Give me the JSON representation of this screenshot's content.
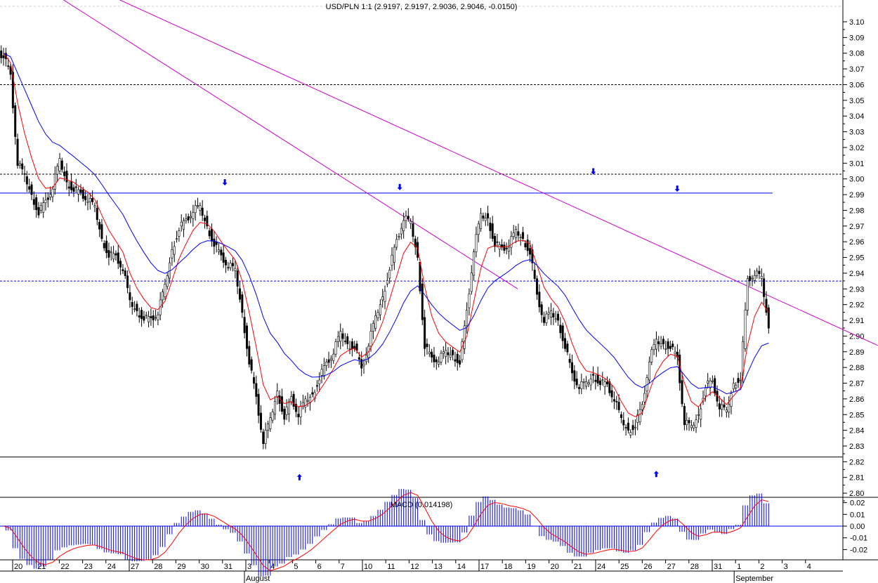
{
  "chart_data": {
    "type": "candlestick",
    "title": "USD/PLN 1:1 (2.9197, 2.9197, 2.9036, 2.9046, -0.0150)",
    "ylim": [
      2.8,
      3.1
    ],
    "yticks": [
      "3.10",
      "3.09",
      "3.08",
      "3.07",
      "3.06",
      "3.05",
      "3.04",
      "3.03",
      "3.02",
      "3.01",
      "3.00",
      "2.99",
      "2.98",
      "2.97",
      "2.96",
      "2.95",
      "2.94",
      "2.93",
      "2.92",
      "2.91",
      "2.90",
      "2.89",
      "2.88",
      "2.87",
      "2.86",
      "2.85",
      "2.84",
      "2.83",
      "2.82",
      "2.81",
      "2.80"
    ],
    "xticks": [
      "20",
      "21",
      "22",
      "23",
      "24",
      "27",
      "28",
      "29",
      "30",
      "31",
      "3",
      "4",
      "5",
      "6",
      "7",
      "10",
      "11",
      "12",
      "13",
      "14",
      "17",
      "18",
      "19",
      "20",
      "21",
      "24",
      "25",
      "26",
      "27",
      "28",
      "31",
      "1",
      "2",
      "3",
      "4"
    ],
    "week_starts": [
      0,
      5,
      10,
      15,
      20,
      25,
      30
    ],
    "months": [
      {
        "label": "August",
        "day_index": 10
      },
      {
        "label": "September",
        "day_index": 31
      }
    ],
    "series_start_day": -0.39,
    "series_step_days": 0.301,
    "closes": [
      3.08,
      3.065,
      3.01,
      3.0,
      2.99,
      2.98,
      2.985,
      2.995,
      3.01,
      2.998,
      2.995,
      2.99,
      2.987,
      2.98,
      2.962,
      2.953,
      2.95,
      2.943,
      2.92,
      2.916,
      2.913,
      2.91,
      2.915,
      2.93,
      2.955,
      2.97,
      2.973,
      2.98,
      2.98,
      2.97,
      2.96,
      2.95,
      2.945,
      2.94,
      2.915,
      2.885,
      2.86,
      2.833,
      2.845,
      2.865,
      2.85,
      2.86,
      2.85,
      2.857,
      2.863,
      2.875,
      2.882,
      2.89,
      2.9,
      2.895,
      2.895,
      2.878,
      2.895,
      2.91,
      2.925,
      2.945,
      2.96,
      2.975,
      2.97,
      2.95,
      2.895,
      2.885,
      2.885,
      2.888,
      2.888,
      2.885,
      2.915,
      2.955,
      2.975,
      2.975,
      2.96,
      2.955,
      2.958,
      2.965,
      2.962,
      2.955,
      2.925,
      2.91,
      2.913,
      2.91,
      2.895,
      2.875,
      2.868,
      2.868,
      2.875,
      2.872,
      2.868,
      2.86,
      2.845,
      2.84,
      2.845,
      2.855,
      2.885,
      2.895,
      2.895,
      2.895,
      2.885,
      2.845,
      2.84,
      2.85,
      2.87,
      2.87,
      2.855,
      2.85,
      2.87,
      2.875,
      2.935,
      2.94,
      2.935,
      2.905
    ],
    "moving_averages": [
      {
        "name": "fast",
        "period": 4,
        "color": "#ff0000"
      },
      {
        "name": "slow",
        "period": 12,
        "color": "#0000ff"
      }
    ],
    "horizontal_lines": [
      {
        "price": 3.06,
        "color": "#000000",
        "style": "dashed"
      },
      {
        "price": 3.003,
        "color": "#000000",
        "style": "dashed"
      },
      {
        "price": 2.991,
        "color": "#0000ff",
        "style": "solid"
      },
      {
        "price": 2.935,
        "color": "#0000ff",
        "style": "dashed"
      },
      {
        "price": 2.823,
        "color": "#000000",
        "style": "solid"
      }
    ],
    "trend_lines": [
      {
        "from": [
          2.17,
          3.114
        ],
        "to": [
          21.66,
          2.93
        ],
        "color": "#cc00cc"
      },
      {
        "from": [
          4.58,
          3.114
        ],
        "to": [
          37.1,
          2.894
        ],
        "color": "#cc00cc"
      }
    ],
    "arrows": [
      {
        "dir": "down",
        "day": 9.1,
        "price": 2.998
      },
      {
        "dir": "down",
        "day": 16.6,
        "price": 2.995
      },
      {
        "dir": "down",
        "day": 24.9,
        "price": 3.005
      },
      {
        "dir": "down",
        "day": 28.5,
        "price": 2.994
      },
      {
        "dir": "up",
        "day": 12.3,
        "price": 2.81
      },
      {
        "dir": "up",
        "day": 27.6,
        "price": 2.812
      }
    ],
    "macd": {
      "label": "MACD (0.014198)",
      "ylim": [
        -0.025,
        0.025
      ],
      "yticks": [
        "0.02",
        "0.01",
        "0.00",
        "-0.01",
        "-0.02"
      ],
      "fast": 4,
      "slow": 12,
      "signal": 3,
      "hist_color": "#0000ff",
      "signal_color": "#ff0000"
    }
  }
}
